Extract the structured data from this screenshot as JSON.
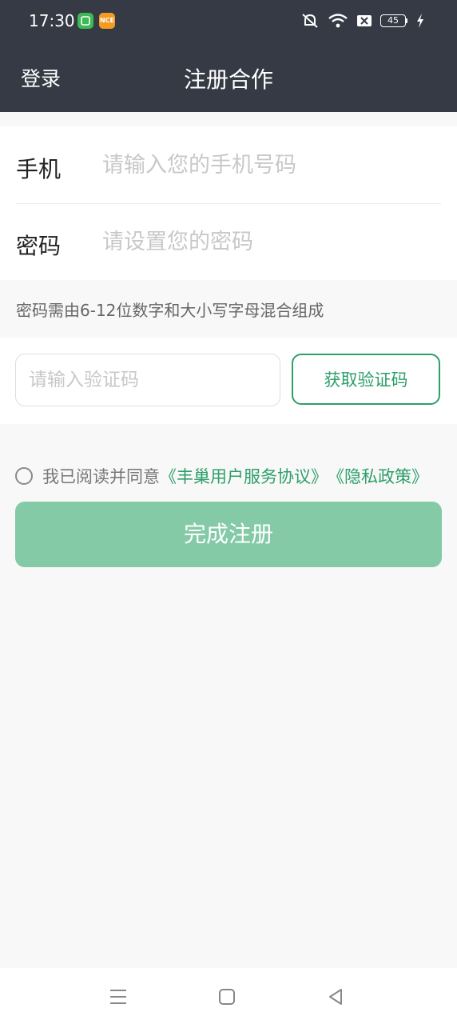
{
  "status_bar": {
    "time": "17:30",
    "badge1_text": "",
    "badge2_text": "NCE",
    "battery_level": "45",
    "icons": [
      "mute-icon",
      "wifi-icon",
      "sim-blocked-icon",
      "battery-icon",
      "charging-icon"
    ]
  },
  "nav": {
    "left_label": "登录",
    "title": "注册合作"
  },
  "form": {
    "phone_label": "手机",
    "phone_placeholder": "请输入您的手机号码",
    "phone_value": "",
    "password_label": "密码",
    "password_placeholder": "请设置您的密码",
    "password_value": ""
  },
  "password_hint": "密码需由6-12位数字和大小写字母混合组成",
  "verification": {
    "placeholder": "请输入验证码",
    "value": "",
    "button_label": "获取验证码"
  },
  "agreement": {
    "prefix": "我已阅读并同意",
    "link1": "《丰巢用户服务协议》",
    "link2": "《隐私政策》",
    "checked": false
  },
  "submit_label": "完成注册",
  "colors": {
    "header_bg": "#353a45",
    "accent": "#2e9e6a",
    "submit_bg": "#84caa6",
    "page_bg": "#f8f8f8"
  },
  "system_nav": [
    "menu-icon",
    "home-icon",
    "back-icon"
  ]
}
